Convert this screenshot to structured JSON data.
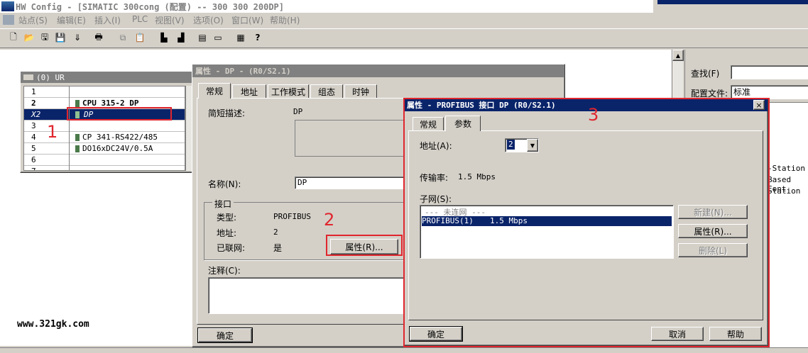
{
  "app": {
    "title": "HW Config - [SIMATIC 300cong (配置) -- 300 300 200DP]"
  },
  "menu": [
    "站点(S)",
    "编辑(E)",
    "插入(I)",
    "PLC",
    "视图(V)",
    "选项(O)",
    "窗口(W)",
    "帮助(H)"
  ],
  "toolbar_icons": [
    "new-icon",
    "open-icon",
    "save-compile-icon",
    "save-icon",
    "download-icon",
    "print-icon",
    "copy-icon",
    "paste-icon",
    "load-station-icon",
    "upload-icon",
    "module-info-icon",
    "window-icon",
    "catalog-icon",
    "help-icon"
  ],
  "rack": {
    "title": "(0) UR",
    "rows": [
      {
        "slot": "1",
        "module": ""
      },
      {
        "slot": "2",
        "module": "CPU 315-2 DP"
      },
      {
        "slot": "X2",
        "module": "DP"
      },
      {
        "slot": "3",
        "module": ""
      },
      {
        "slot": "4",
        "module": "CP 341-RS422/485"
      },
      {
        "slot": "5",
        "module": "DO16xDC24V/0.5A"
      },
      {
        "slot": "6",
        "module": ""
      },
      {
        "slot": "7",
        "module": ""
      }
    ]
  },
  "catalog": {
    "search_label": "查找(F)",
    "profile_label": "配置文件:",
    "profile_value": "标准",
    "items": [
      "-Station",
      "Based Cont",
      "Station"
    ]
  },
  "watermark": "www.321gk.com",
  "annotations": [
    "1",
    "2",
    "3"
  ],
  "dp_dialog": {
    "title": "属性 - DP - (R0/S2.1)",
    "tabs": [
      "常规",
      "地址",
      "工作模式",
      "组态",
      "时钟"
    ],
    "short_desc_label": "简短描述:",
    "short_desc_value": "DP",
    "name_label": "名称(N):",
    "name_value": "DP",
    "interface_group": "接口",
    "type_label": "类型:",
    "type_value": "PROFIBUS",
    "address_label": "地址:",
    "address_value": "2",
    "networked_label": "已联网:",
    "networked_value": "是",
    "properties_button": "属性(R)...",
    "comment_label": "注释(C):",
    "ok_button": "确定"
  },
  "pb_dialog": {
    "title": "属性 - PROFIBUS 接口 DP (R0/S2.1)",
    "close": "×",
    "tabs": [
      "常规",
      "参数"
    ],
    "address_label": "地址(A):",
    "address_value": "2",
    "rate_label": "传输率:",
    "rate_value": "1.5 Mbps",
    "subnet_label": "子网(S):",
    "subnet_items": [
      {
        "name": "--- 未连网 ---",
        "rate": ""
      },
      {
        "name": "PROFIBUS(1)",
        "rate": "1.5 Mbps"
      }
    ],
    "new_button": "新建(N)...",
    "properties_button": "属性(R)...",
    "delete_button": "删除(L)",
    "ok_button": "确定",
    "cancel_button": "取消",
    "help_button": "帮助"
  }
}
